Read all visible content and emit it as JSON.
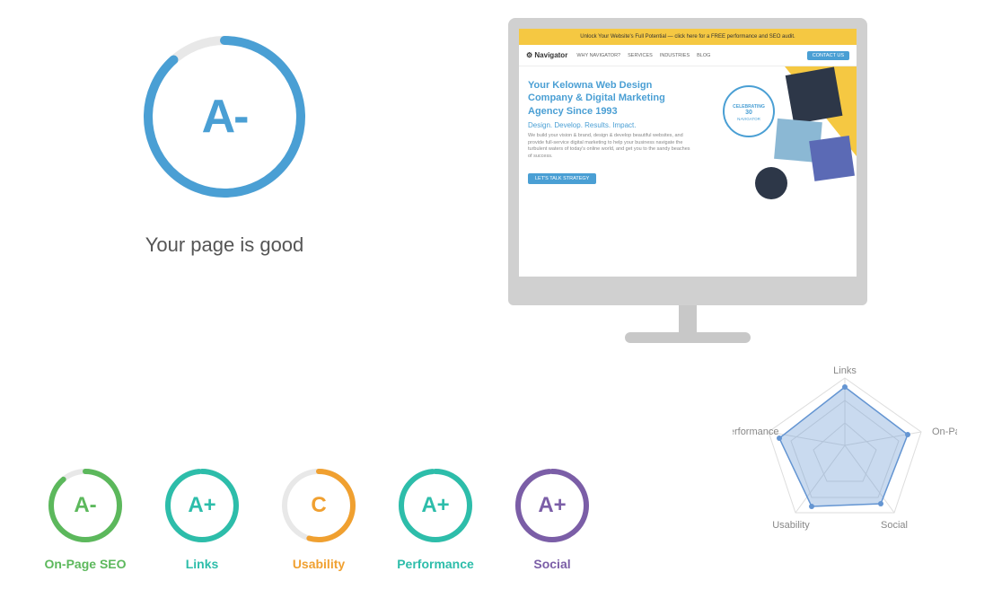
{
  "main_grade": {
    "letter": "A-",
    "color": "#4a9fd4",
    "status_text": "Your page is good"
  },
  "monitor": {
    "site_topbar": "Unlock Your Website's Full Potential — click here for a FREE performance and SEO audit.",
    "nav_logo": "Navigator",
    "nav_items": [
      "WHY NAVIGATOR?",
      "SERVICES",
      "INDUSTRIES",
      "BLOG"
    ],
    "nav_cta": "CONTACT US",
    "hero_title": "Your Kelowna Web Design Company & Digital Marketing Agency Since 1993",
    "hero_subtitle": "Design. Develop. Results. Impact.",
    "hero_text": "We build your vision & brand, design & develop beautiful websites, and provide full-service digital marketing to help your business navigate the turbulent waters of today's online world, and get you to the sandy beaches of success.",
    "hero_cta": "LET'S TALK STRATEGY"
  },
  "metrics": [
    {
      "id": "on-page-seo",
      "grade": "A-",
      "label": "On-Page SEO",
      "color": "#5cb85c",
      "track_color": "#e0e0e0",
      "percent": 88
    },
    {
      "id": "links",
      "grade": "A+",
      "label": "Links",
      "color": "#2dbdaa",
      "track_color": "#e0e0e0",
      "percent": 99
    },
    {
      "id": "usability",
      "grade": "C",
      "label": "Usability",
      "color": "#f0a030",
      "track_color": "#e0e0e0",
      "percent": 55
    },
    {
      "id": "performance",
      "grade": "A+",
      "label": "Performance",
      "color": "#2dbdaa",
      "track_color": "#e0e0e0",
      "percent": 99
    },
    {
      "id": "social",
      "grade": "A+",
      "label": "Social",
      "color": "#7b5ea7",
      "track_color": "#e0e0e0",
      "percent": 99
    }
  ],
  "spider": {
    "labels": [
      "Links",
      "On-Page SEO",
      "Social",
      "Usability",
      "Performance"
    ],
    "fill_color": "rgba(100, 149, 210, 0.4)",
    "stroke_color": "#6495d2"
  }
}
